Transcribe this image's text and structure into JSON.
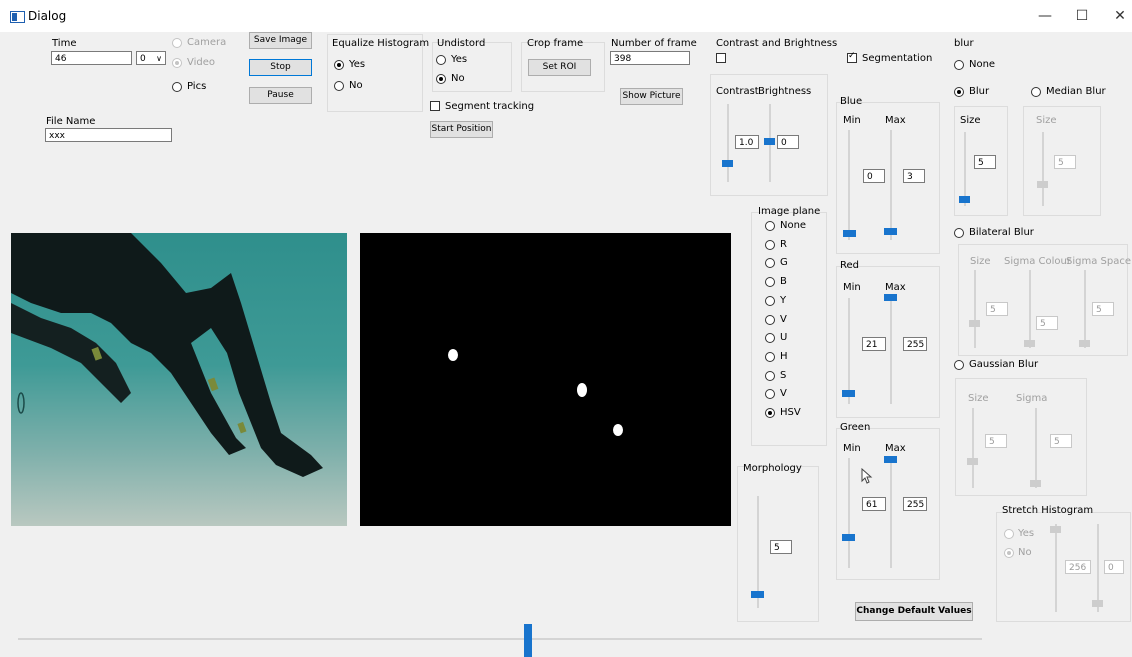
{
  "window": {
    "title": "Dialog",
    "minimize": "—",
    "maximize": "☐",
    "close": "✕"
  },
  "time": {
    "label": "Time",
    "value": "46",
    "combo_value": "0",
    "combo_arrow": "∨"
  },
  "source": {
    "camera": "Camera",
    "video": "Video",
    "pics": "Pics",
    "selected": "pics"
  },
  "buttons": {
    "save_image": "Save Image",
    "stop": "Stop",
    "pause": "Pause",
    "set_roi": "Set ROI",
    "show_picture": "Show Picture",
    "start_position": "Start Position",
    "change_defaults": "Change Default Values"
  },
  "file_name": {
    "label": "File Name",
    "value": "xxx"
  },
  "equalize": {
    "label": "Equalize Histogram",
    "yes": "Yes",
    "no": "No",
    "selected": "yes"
  },
  "undistort": {
    "label": "Undistord",
    "yes": "Yes",
    "no": "No",
    "selected": "no"
  },
  "crop": {
    "label": "Crop frame"
  },
  "frames": {
    "label": "Number of frame",
    "value": "398"
  },
  "segment_tracking": {
    "label": "Segment tracking",
    "checked": false
  },
  "contrast_brightness": {
    "label": "Contrast and Brightness",
    "checked": false,
    "contrast_label": "Contrast",
    "brightness_label": "Brightness",
    "contrast_value": "1.0",
    "brightness_value": "0"
  },
  "segmentation": {
    "label": "Segmentation",
    "checked": true
  },
  "blue": {
    "label": "Blue",
    "min_label": "Min",
    "max_label": "Max",
    "min_value": "0",
    "max_value": "3"
  },
  "red": {
    "label": "Red",
    "min_label": "Min",
    "max_label": "Max",
    "min_value": "21",
    "max_value": "255"
  },
  "green": {
    "label": "Green",
    "min_label": "Min",
    "max_label": "Max",
    "min_value": "61",
    "max_value": "255"
  },
  "image_plane": {
    "label": "Image plane",
    "options": [
      "None",
      "R",
      "G",
      "B",
      "Y",
      "V",
      "U",
      "H",
      "S",
      "V",
      "HSV"
    ],
    "selected_index": 10
  },
  "morphology": {
    "label": "Morphology",
    "value": "5"
  },
  "blur": {
    "label": "blur",
    "none": "None",
    "blur": "Blur",
    "median": "Median Blur",
    "selected": "blur",
    "blur_size_label": "Size",
    "blur_size_value": "5",
    "median_size_label": "Size",
    "median_size_value": "5",
    "bilateral": "Bilateral Blur",
    "bilateral_size_label": "Size",
    "bilateral_sigma_colour_label": "Sigma Colour",
    "bilateral_sigma_space_label": "Sigma Space",
    "bilateral_size_value": "5",
    "bilateral_sigma_colour_value": "5",
    "bilateral_sigma_space_value": "5",
    "gaussian": "Gaussian Blur",
    "gaussian_size_label": "Size",
    "gaussian_sigma_label": "Sigma",
    "gaussian_size_value": "5",
    "gaussian_sigma_value": "5"
  },
  "stretch": {
    "label": "Stretch Histogram",
    "yes": "Yes",
    "no": "No",
    "selected": "no",
    "value1": "256",
    "value2": "0"
  },
  "colors": {
    "accent": "#1874cd",
    "focus": "#0078d7"
  }
}
